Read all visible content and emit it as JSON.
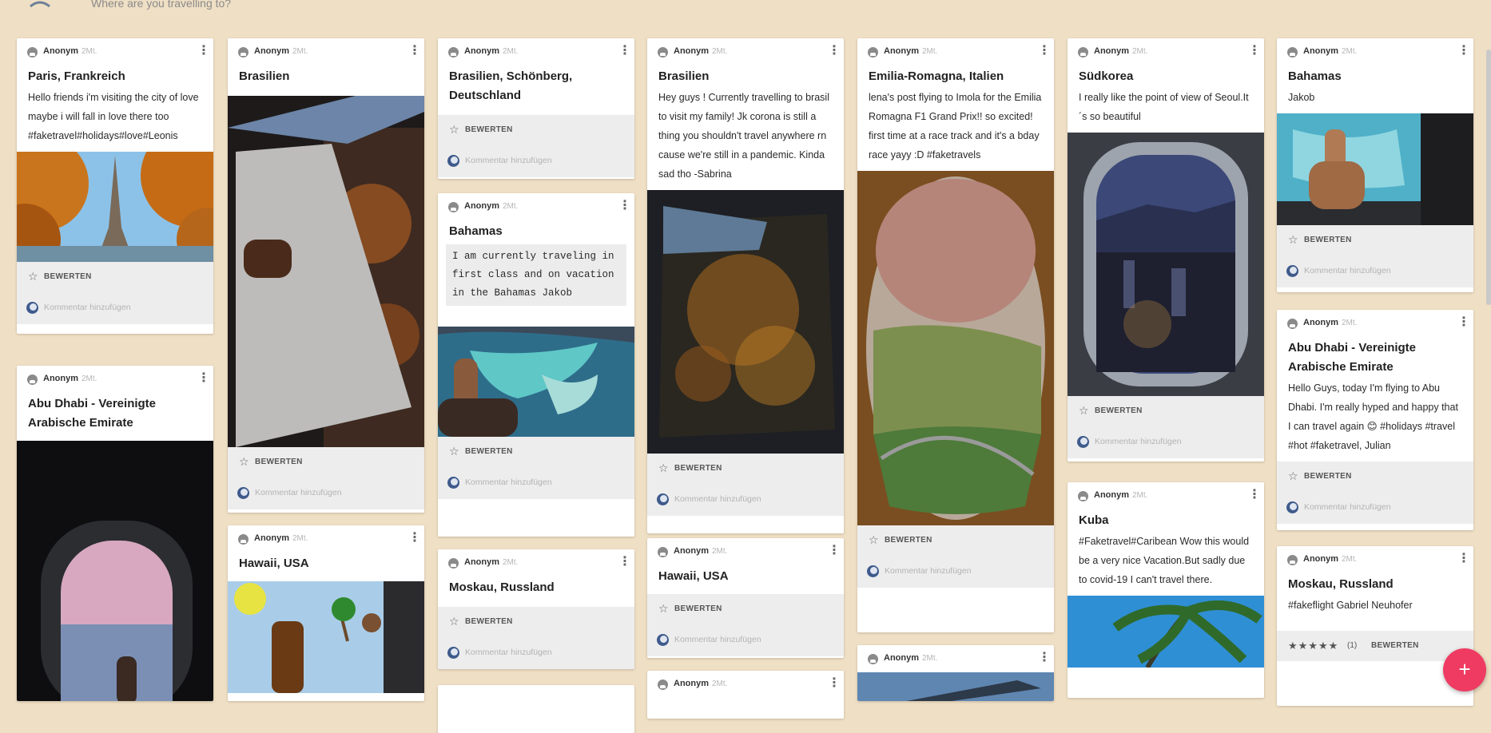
{
  "search": {
    "placeholder": "Where are you travelling to?"
  },
  "labels": {
    "author": "Anonym",
    "age": "2Mt.",
    "rate": "BEWERTEN",
    "comment": "Kommentar hinzufügen",
    "more": "⋮",
    "star_outline": "☆",
    "star_filled": "★★★★★",
    "rating_count": "(1)",
    "fab": "+"
  },
  "cards": [
    {
      "title": "Paris, Frankreich",
      "text": "Hello friends i'm visiting the city of love maybe i will fall in love there too #faketravel#holidays#love#Leonis",
      "image": "eiffel-tower-autumn"
    },
    {
      "title": "Abu Dhabi - Vereinigte Arabische Emirate",
      "text": "",
      "image": "airplane-window-sunset"
    },
    {
      "title": "Brasilien",
      "text": "",
      "image": "airplane-wing-city-lights"
    },
    {
      "title": "Hawaii, USA",
      "text": "",
      "image": "beer-bottle-airplane-window"
    },
    {
      "title": "Brasilien, Schönberg, Deutschland",
      "text": "",
      "image": ""
    },
    {
      "title": "Bahamas",
      "text": "I am currently traveling in first class and on vacation in the Bahamas Jakob",
      "image": "thumbs-up-island-view"
    },
    {
      "title": "Moskau, Russland",
      "text": "",
      "image": ""
    },
    {
      "title": "Brasilien",
      "text": "Hey guys ! Currently travelling to brasil to visit my family! Jk corona is still a thing you shouldn't travel anywhere rn cause we're still in a pandemic. Kinda sad tho -Sabrina",
      "image": "night-city-from-plane"
    },
    {
      "title": "Hawaii, USA",
      "text": "",
      "image": ""
    },
    {
      "title": "Emilia-Romagna, Italien",
      "text": "lena's post flying to Imola for the Emilia Romagna F1 Grand Prix!! so excited! first time at a race track and it's a bday race yayy :D #faketravels",
      "image": "town-aerial-porthole"
    },
    {
      "title": "Südkorea",
      "text": "I really like the point of view of Seoul.It´s so beautiful",
      "image": "seoul-night-window"
    },
    {
      "title": "Kuba",
      "text": "#Faketravel#Caribean Wow this would be a very nice Vacation.But sadly due to covid-19 I can't travel there.",
      "image": "palm-tree-sky"
    },
    {
      "title": "Bahamas",
      "text": "Jakob",
      "image": "thumbs-up-laptop"
    },
    {
      "title": "Abu Dhabi - Vereinigte Arabische Emirate",
      "text": "Hello Guys, today I'm flying to Abu Dhabi. I'm really hyped and happy that I can travel again 😊 #holidays #travel #hot #faketravel, Julian",
      "image": ""
    },
    {
      "title": "Moskau, Russland",
      "text": "#fakeflight Gabriel Neuhofer",
      "image": ""
    }
  ],
  "colors": {
    "background": "#efdfc4",
    "fab": "#ef3b62",
    "footer": "#ededed"
  }
}
